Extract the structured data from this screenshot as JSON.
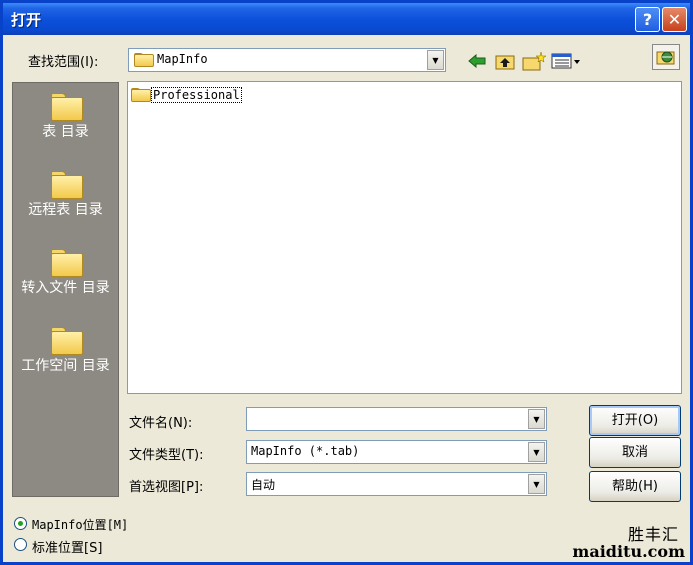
{
  "window": {
    "title": "打开"
  },
  "lookin": {
    "label": "查找范围(I):",
    "value": "MapInfo"
  },
  "places": [
    {
      "label": "表 目录"
    },
    {
      "label": "远程表 目录"
    },
    {
      "label": "转入文件 目录"
    },
    {
      "label": "工作空间 目录"
    }
  ],
  "files": [
    {
      "name": "Professional"
    }
  ],
  "fields": {
    "filename_label": "文件名(N):",
    "filename_value": "",
    "filetype_label": "文件类型(T):",
    "filetype_value": "MapInfo (*.tab)",
    "view_label": "首选视图[P]:",
    "view_value": "自动"
  },
  "buttons": {
    "open": "打开(O)",
    "cancel": "取消",
    "help": "帮助(H)"
  },
  "radios": {
    "mapinfo": {
      "label": "MapInfo位置[M]",
      "checked": true
    },
    "standard": {
      "label": "标准位置[S]",
      "checked": false
    }
  },
  "watermark": {
    "text1": "胜丰汇",
    "text2": "maiditu.com"
  }
}
